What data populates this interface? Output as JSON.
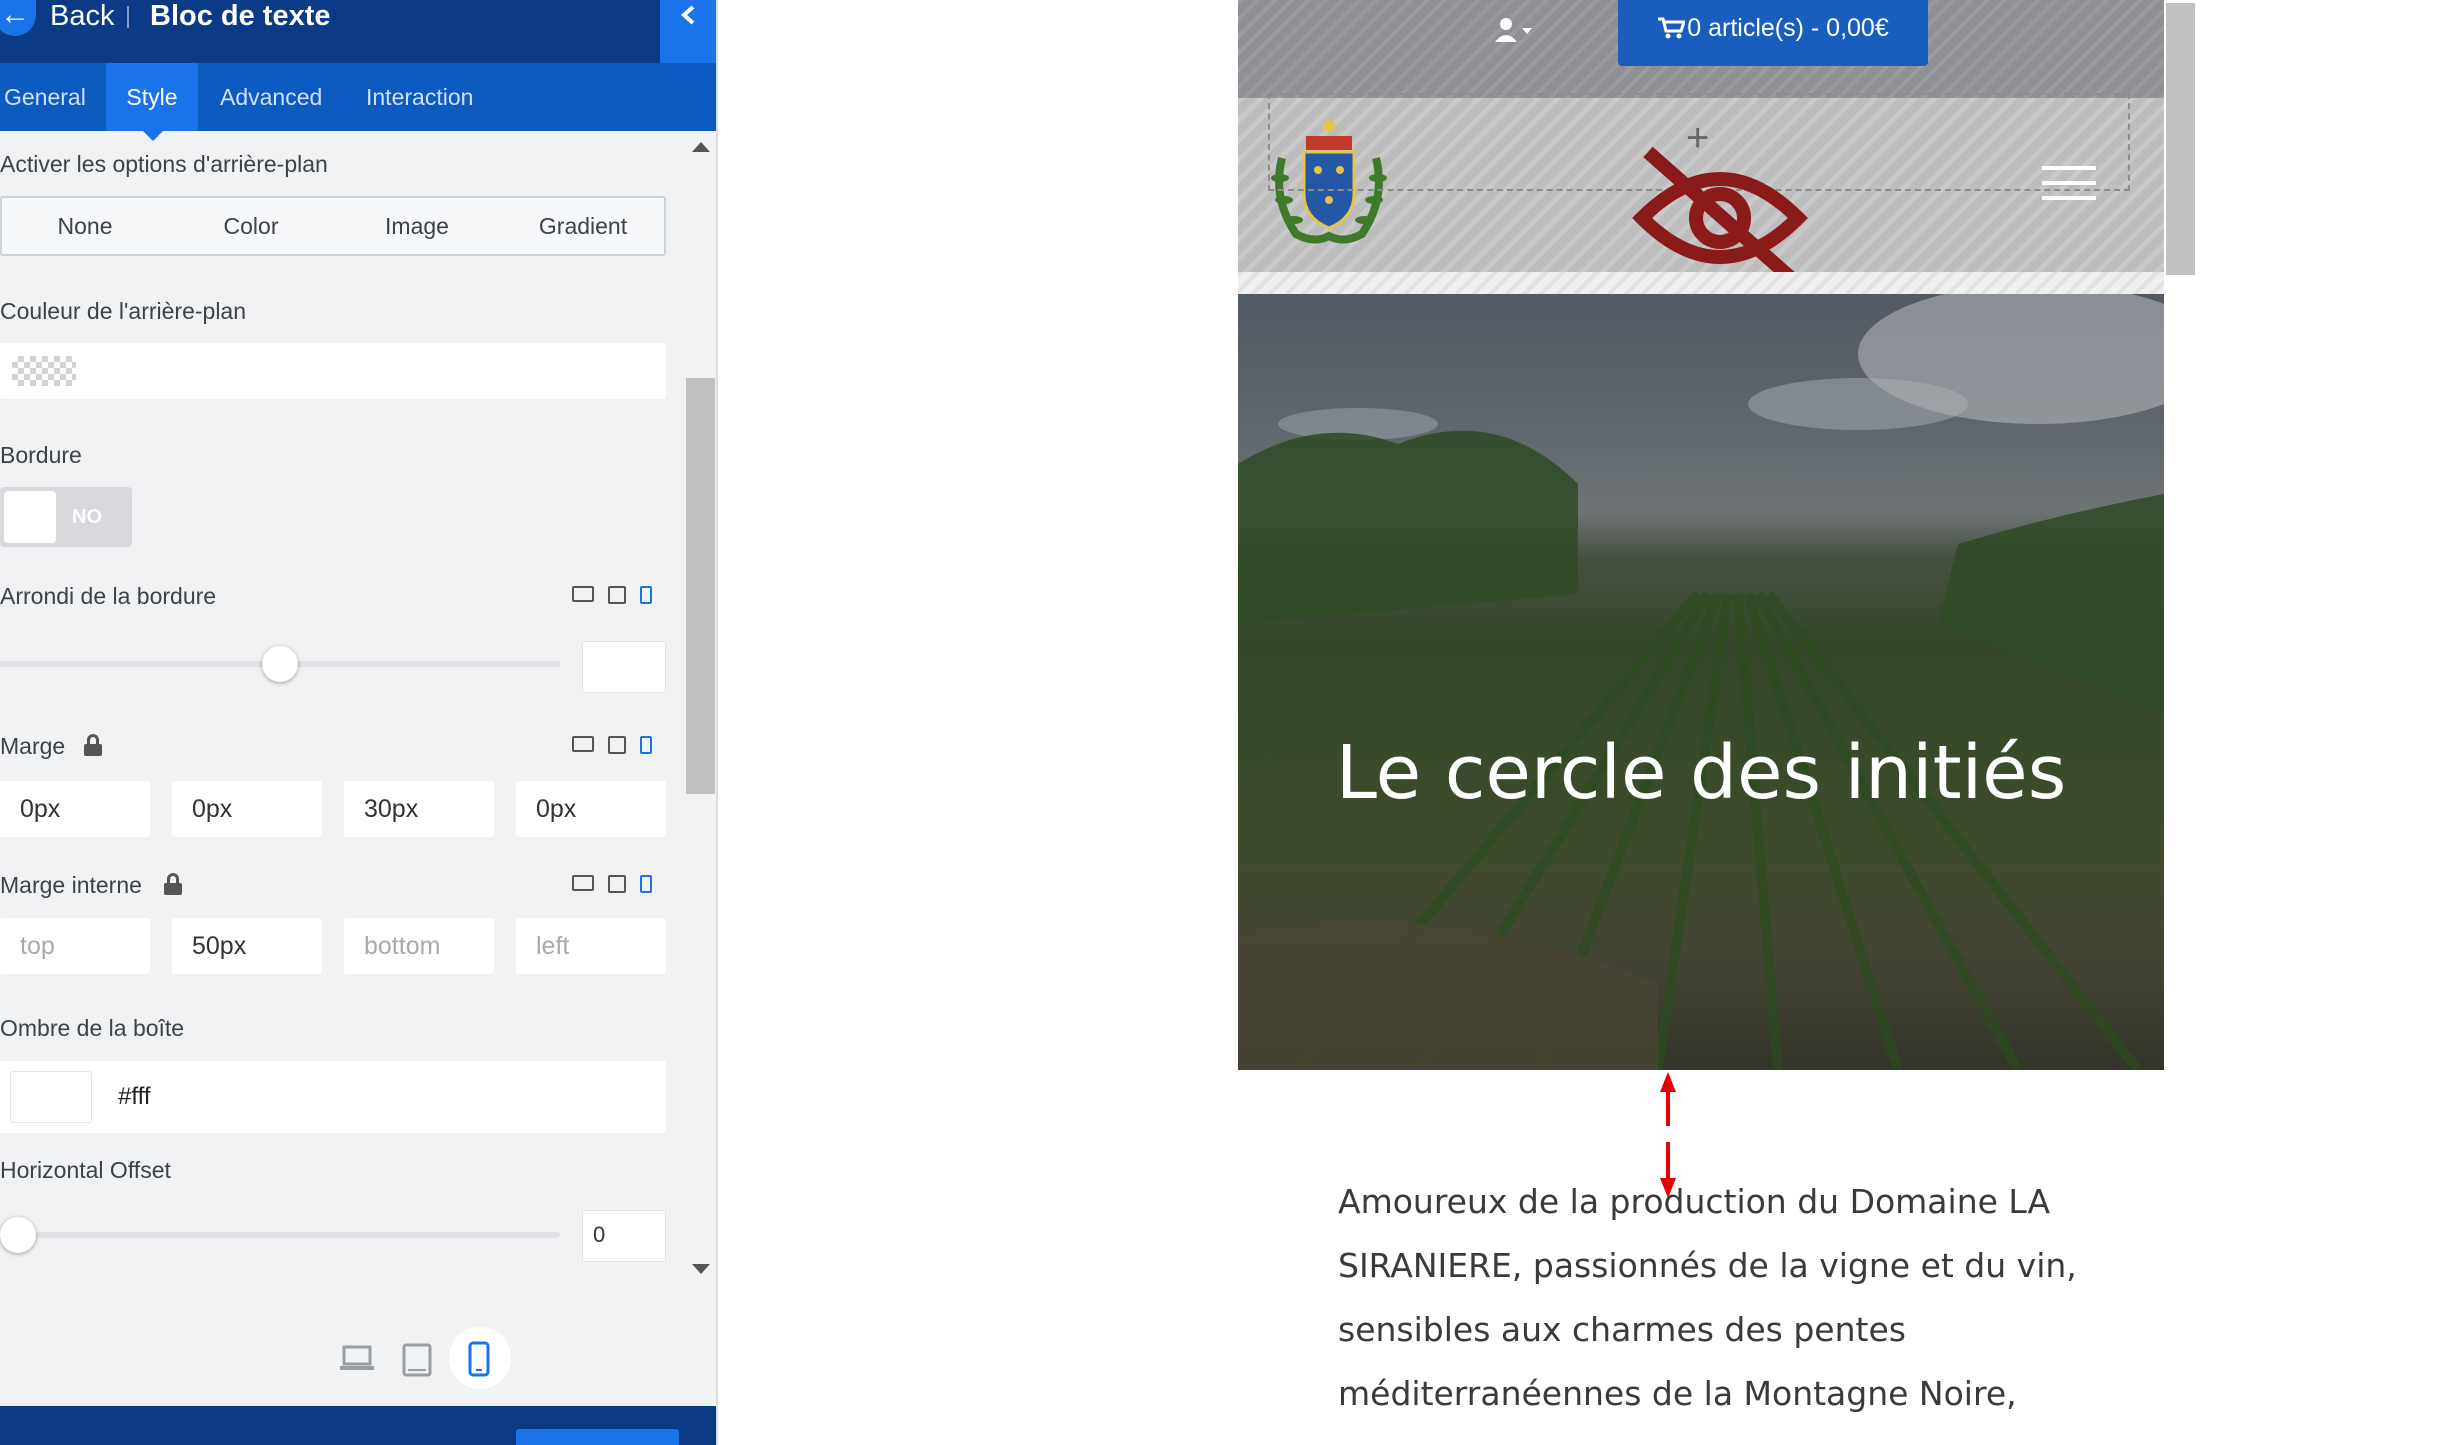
{
  "topbar": {
    "back_label": "Back",
    "title": "Bloc de texte"
  },
  "tabs": [
    "General",
    "Style",
    "Advanced",
    "Interaction"
  ],
  "style": {
    "bg_options_label": "Activer les options d'arrière-plan",
    "bg_options": [
      "None",
      "Color",
      "Image",
      "Gradient"
    ],
    "bg_color_label": "Couleur de l'arrière-plan",
    "border_label": "Bordure",
    "border_toggle": "NO",
    "radius_label": "Arrondi de la bordure",
    "margin_label": "Marge",
    "margin_values": [
      "0px",
      "0px",
      "30px",
      "0px"
    ],
    "padding_label": "Marge interne",
    "padding_values": [
      "",
      "50px",
      "",
      ""
    ],
    "padding_placeholders": [
      "top",
      "",
      "bottom",
      "left"
    ],
    "shadow_label": "Ombre de la boîte",
    "shadow_color": "#fff",
    "hoffset_label": "Horizontal Offset",
    "hoffset_value": "0"
  },
  "preview": {
    "cart_text": "0 article(s) - 0,00€",
    "hero_title": "Le cercle des initiés",
    "body_text": "Amoureux de la production du Domaine LA SIRANIERE, passionnés de la vigne et du vin, sensibles aux charmes des pentes méditerranéennes de la Montagne Noire,"
  },
  "colors": {
    "accent": "#1a73e8",
    "topbar": "#0b3a86",
    "tabbar": "#0d5bc0",
    "hidden_eye": "#8b1a1a",
    "spacing_arrow": "#e60000"
  }
}
